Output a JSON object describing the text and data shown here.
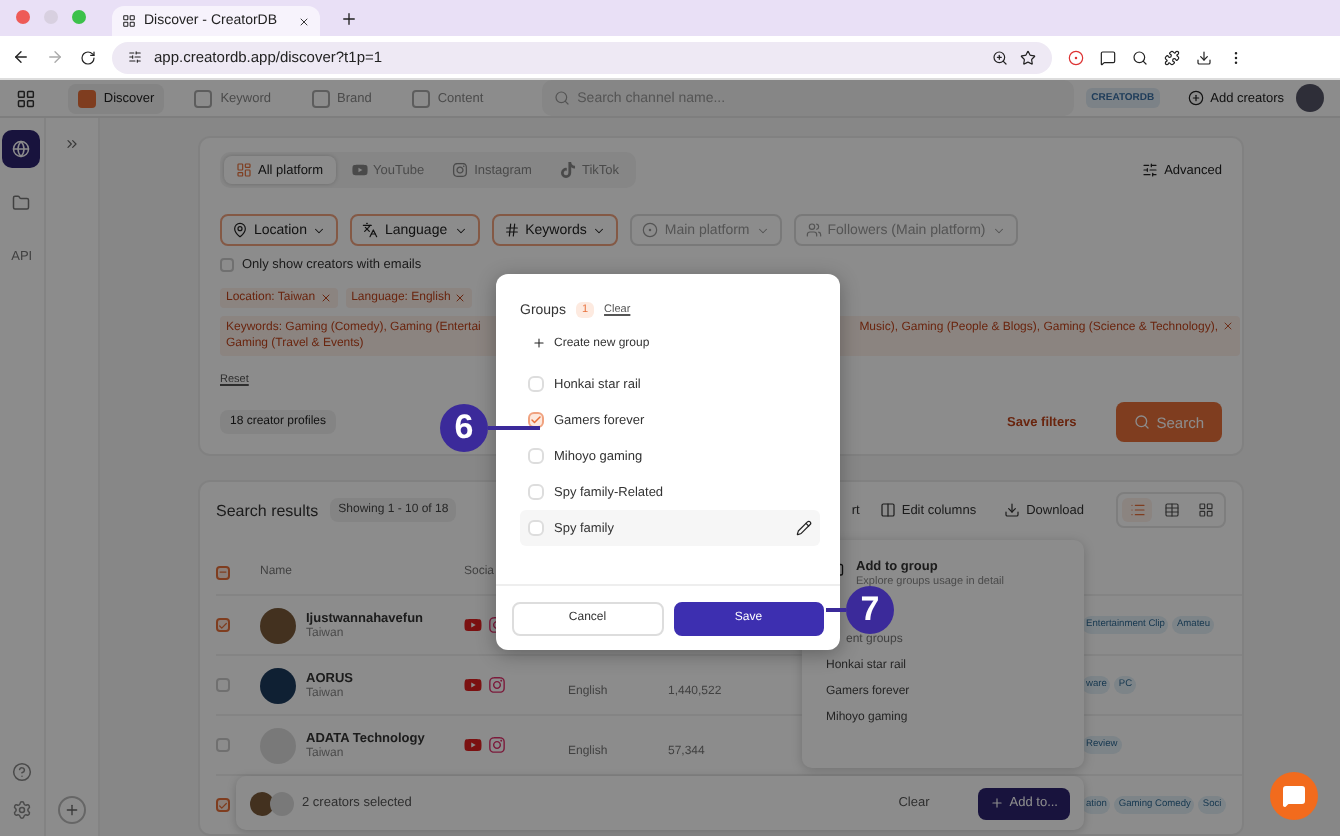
{
  "browser": {
    "tab_title": "Discover - CreatorDB",
    "url": "app.creatordb.app/discover?t1p=1"
  },
  "nav": {
    "items": [
      {
        "label": "Discover",
        "selected": true
      },
      {
        "label": "Keyword",
        "selected": false
      },
      {
        "label": "Brand",
        "selected": false
      },
      {
        "label": "Content",
        "selected": false
      }
    ],
    "search_placeholder": "Search channel name...",
    "brand": "CREATORDB",
    "add_creators": "Add creators"
  },
  "sidebar": {
    "items": [
      {
        "kind": "globe",
        "selected": true
      },
      {
        "kind": "folder",
        "selected": false
      },
      {
        "kind": "text",
        "label": "API",
        "selected": false
      }
    ]
  },
  "filters": {
    "platform_tabs": [
      {
        "label": "All platform",
        "kind": "all",
        "selected": true
      },
      {
        "label": "YouTube",
        "kind": "youtube",
        "selected": false
      },
      {
        "label": "Instagram",
        "kind": "instagram",
        "selected": false
      },
      {
        "label": "TikTok",
        "kind": "tiktok",
        "selected": false
      }
    ],
    "advanced": "Advanced",
    "dropdowns": [
      {
        "label": "Location",
        "kind": "location",
        "applied": true
      },
      {
        "label": "Language",
        "kind": "language",
        "applied": true
      },
      {
        "label": "Keywords",
        "kind": "keywords",
        "applied": true
      },
      {
        "label": "Main platform",
        "kind": "platform",
        "applied": false
      },
      {
        "label": "Followers (Main platform)",
        "kind": "followers",
        "applied": false
      }
    ],
    "email_filter": {
      "label": "Only show creators with emails",
      "checked": false
    },
    "tags": [
      "Location: Taiwan",
      "Language: English"
    ],
    "keyword_tag": {
      "start": "Keywords: Gaming (Comedy), Gaming (Entertai",
      "end": "Music), Gaming (People & Blogs), Gaming (Science & Technology),",
      "last_line": "Gaming (Travel & Events)"
    },
    "reset": "Reset",
    "profile_count": "18 creator profiles",
    "save_filters": "Save filters",
    "search_button": "Search"
  },
  "results": {
    "title": "Search results",
    "showing": "Showing 1 - 10 of 18",
    "sort_fragment": "rt",
    "edit_columns": "Edit columns",
    "download": "Download",
    "views": [
      {
        "kind": "list",
        "selected": true
      },
      {
        "kind": "table",
        "selected": false
      },
      {
        "kind": "grid",
        "selected": false
      }
    ],
    "header_checkbox": {
      "partial": true
    },
    "columns": [
      "Name",
      "Socia"
    ],
    "rows": [
      {
        "name": "Ijustwannahavefun",
        "location": "Taiwan",
        "checked": true,
        "tags": [
          "Entertainment Clip",
          "Amateu"
        ]
      },
      {
        "name": "AORUS",
        "location": "Taiwan",
        "checked": false,
        "language": "English",
        "followers": "1,440,522",
        "tags": [
          "ware",
          "PC"
        ]
      },
      {
        "name": "ADATA Technology",
        "location": "Taiwan",
        "checked": false,
        "language": "English",
        "followers": "57,344",
        "tags": [
          "Review"
        ]
      },
      {
        "checked": true,
        "tags": [
          "ation",
          "Gaming Comedy",
          "Soci"
        ]
      }
    ]
  },
  "selection_bar": {
    "text": "2 creators selected",
    "clear": "Clear",
    "add_to": "Add to..."
  },
  "popover": {
    "title": "Add to group",
    "subtitle": "Explore groups usage in detail",
    "section": "ent groups",
    "items": [
      "Honkai star rail",
      "Gamers forever",
      "Mihoyo gaming"
    ]
  },
  "modal": {
    "title": "Groups",
    "count": "1",
    "clear": "Clear",
    "create": "Create new group",
    "groups": [
      {
        "label": "Honkai star rail",
        "checked": false,
        "hovered": false
      },
      {
        "label": "Gamers forever",
        "checked": true,
        "hovered": false
      },
      {
        "label": "Mihoyo gaming",
        "checked": false,
        "hovered": false
      },
      {
        "label": "Spy family-Related",
        "checked": false,
        "hovered": false
      },
      {
        "label": "Spy family",
        "checked": false,
        "hovered": true
      }
    ],
    "cancel": "Cancel",
    "save": "Save"
  },
  "markers": [
    {
      "label": "6"
    },
    {
      "label": "7"
    }
  ]
}
